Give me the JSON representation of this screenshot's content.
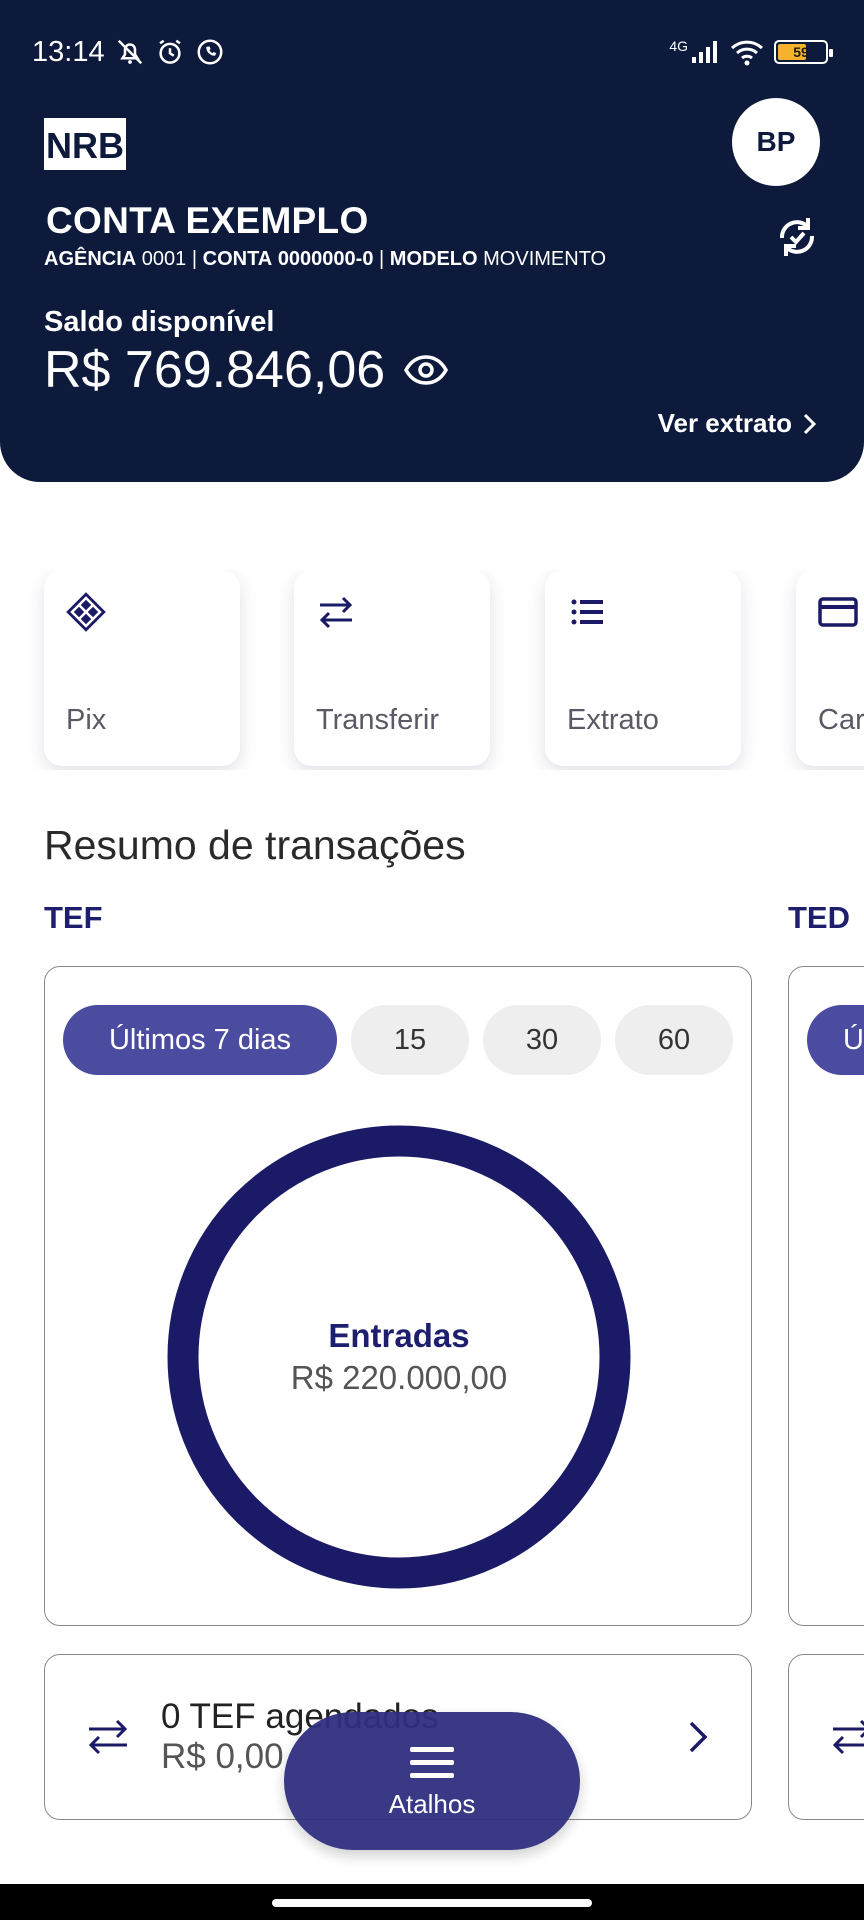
{
  "status_bar": {
    "time": "13:14",
    "network": "4G",
    "battery_level": "59",
    "icons": [
      "muted-bell-icon",
      "alarm-icon",
      "whatsapp-icon",
      "signal-icon",
      "wifi-icon",
      "battery-icon"
    ]
  },
  "header": {
    "logo_text": "NRB",
    "avatar_initials": "BP",
    "account_name": "CONTA EXEMPLO",
    "agencia_label": "AGÊNCIA",
    "agencia_value": "0001",
    "conta_label": "CONTA",
    "conta_value": "0000000-0",
    "modelo_label": "MODELO",
    "modelo_value": "MOVIMENTO",
    "separator": "|",
    "balance_label": "Saldo disponível",
    "balance_value": "R$ 769.846,06",
    "statement_link": "Ver extrato",
    "background": "#0d1a3c"
  },
  "quick_actions": [
    {
      "label": "Pix",
      "icon": "pix-icon"
    },
    {
      "label": "Transferir",
      "icon": "transfer-icon"
    },
    {
      "label": "Extrato",
      "icon": "list-icon"
    },
    {
      "label": "Car",
      "icon": "card-icon"
    }
  ],
  "summary": {
    "title": "Resumo de transações",
    "tabs": [
      "TEF",
      "TED"
    ],
    "filters": [
      "Últimos 7 dias",
      "15",
      "30",
      "60"
    ],
    "selected_filter": "Últimos 7 dias",
    "peek_filter": "Úl",
    "donut_title": "Entradas",
    "donut_value": "R$ 220.000,00",
    "donut_color": "#1b1a66",
    "accent": "#4b4ba0"
  },
  "scheduled": {
    "title": "0 TEF agendados",
    "amount": "R$ 0,00"
  },
  "fab": {
    "label": "Atalhos"
  }
}
